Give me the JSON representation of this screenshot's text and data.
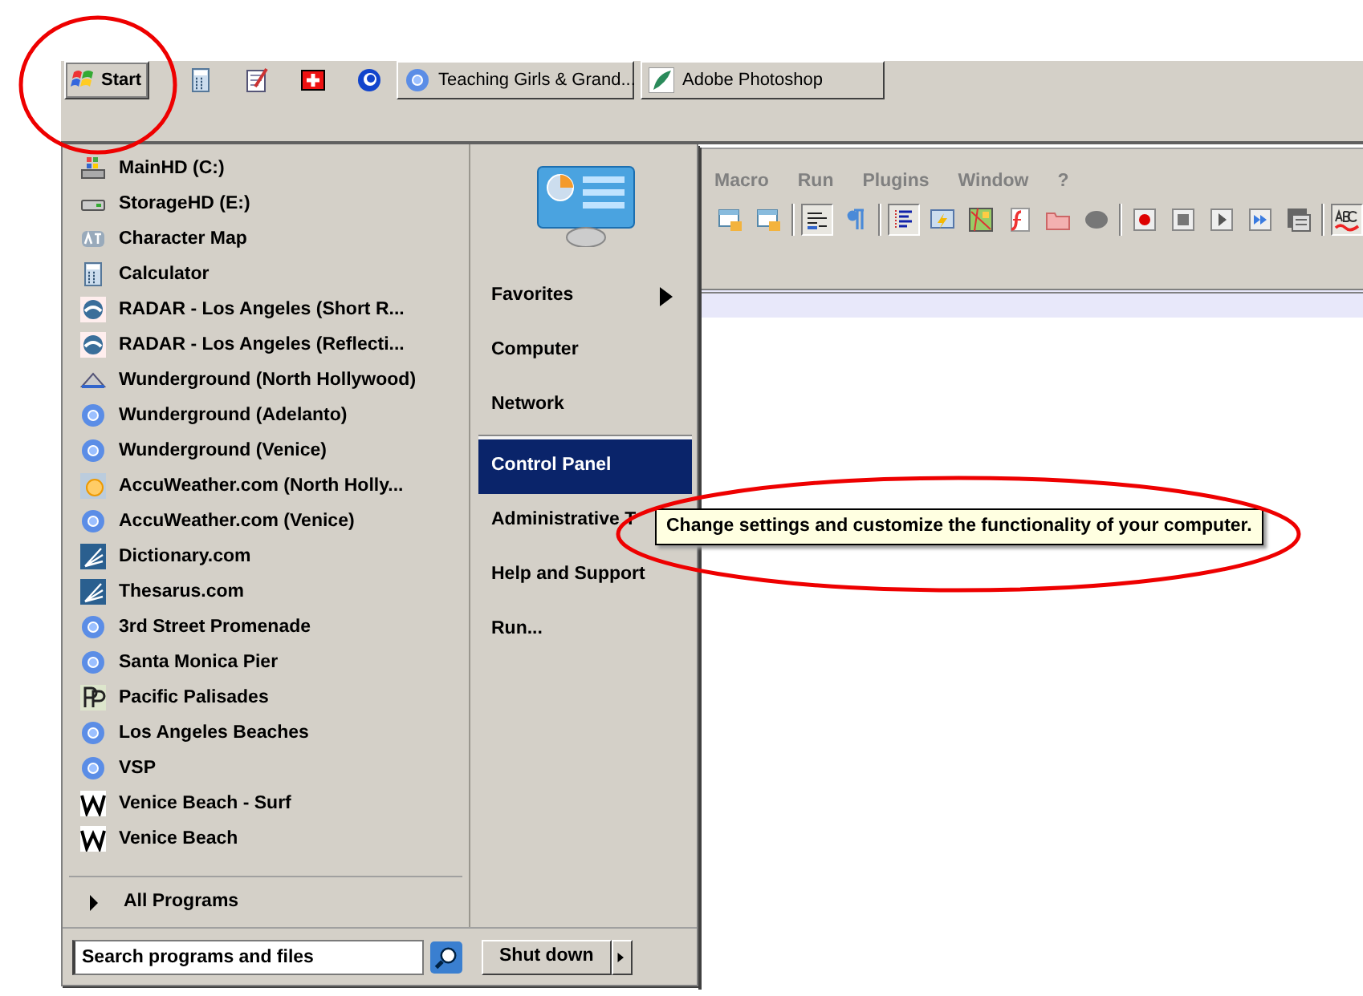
{
  "taskbar": {
    "start_button": "Start",
    "quick_launch": [
      {
        "kind": "calculator"
      },
      {
        "kind": "notepad"
      },
      {
        "kind": "firstaid"
      },
      {
        "kind": "swirl"
      }
    ],
    "tasks": [
      {
        "label": "Teaching Girls & Grand...",
        "kind": "chrome"
      },
      {
        "label": "Adobe Photoshop",
        "kind": "feather"
      }
    ]
  },
  "start_menu": {
    "programs": [
      {
        "label": "MainHD (C:)",
        "kind": "windrive"
      },
      {
        "label": "StorageHD (E:)",
        "kind": "drive"
      },
      {
        "label": "Character Map",
        "kind": "charmap"
      },
      {
        "label": "Calculator",
        "kind": "calculator"
      },
      {
        "label": "RADAR - Los Angeles (Short R...",
        "kind": "radar"
      },
      {
        "label": "RADAR - Los Angeles (Reflecti...",
        "kind": "radar"
      },
      {
        "label": "Wunderground (North Hollywood)",
        "kind": "cloud"
      },
      {
        "label": "Wunderground (Adelanto)",
        "kind": "chrome"
      },
      {
        "label": "Wunderground (Venice)",
        "kind": "chrome"
      },
      {
        "label": "AccuWeather.com (North Holly...",
        "kind": "sun"
      },
      {
        "label": "AccuWeather.com (Venice)",
        "kind": "chrome"
      },
      {
        "label": "Dictionary.com",
        "kind": "dictionary"
      },
      {
        "label": "Thesarus.com",
        "kind": "dictionary"
      },
      {
        "label": "3rd Street Promenade",
        "kind": "chrome"
      },
      {
        "label": "Santa Monica Pier",
        "kind": "chrome"
      },
      {
        "label": "Pacific Palisades",
        "kind": "pp"
      },
      {
        "label": "Los Angeles Beaches",
        "kind": "chrome"
      },
      {
        "label": "VSP",
        "kind": "chrome"
      },
      {
        "label": "Venice Beach - Surf",
        "kind": "w"
      },
      {
        "label": "Venice Beach",
        "kind": "w"
      }
    ],
    "all_programs": "All Programs",
    "places": [
      {
        "label": "Favorites",
        "submenu": true,
        "selected": false
      },
      {
        "label": "Computer",
        "submenu": false,
        "selected": false
      },
      {
        "label": "Network",
        "submenu": false,
        "selected": false
      },
      {
        "label": "Control Panel",
        "submenu": false,
        "selected": true
      },
      {
        "label": "Administrative T",
        "submenu": false,
        "selected": false
      },
      {
        "label": "Help and Support",
        "submenu": false,
        "selected": false
      },
      {
        "label": "Run...",
        "submenu": false,
        "selected": false
      }
    ],
    "search": {
      "placeholder": "Search programs and files"
    },
    "shutdown": "Shut down"
  },
  "tooltip": "Change settings and customize the functionality of your computer.",
  "app": {
    "menu": [
      "Macro",
      "Run",
      "Plugins",
      "Window",
      "?"
    ],
    "toolbar": [
      {
        "kind": "lockwin",
        "pressed": false
      },
      {
        "kind": "lockwin",
        "pressed": false
      },
      {
        "kind": "sep"
      },
      {
        "kind": "wrap",
        "pressed": true
      },
      {
        "kind": "pilcrow",
        "pressed": false
      },
      {
        "kind": "sep"
      },
      {
        "kind": "indent",
        "pressed": true
      },
      {
        "kind": "bolt",
        "pressed": false
      },
      {
        "kind": "map",
        "pressed": false
      },
      {
        "kind": "func",
        "pressed": false
      },
      {
        "kind": "folder",
        "pressed": false
      },
      {
        "kind": "blob",
        "pressed": false
      },
      {
        "kind": "sep"
      },
      {
        "kind": "record",
        "pressed": false
      },
      {
        "kind": "stop",
        "pressed": false
      },
      {
        "kind": "play",
        "pressed": false
      },
      {
        "kind": "ffwd",
        "pressed": false
      },
      {
        "kind": "save",
        "pressed": false
      },
      {
        "kind": "sep"
      },
      {
        "kind": "spell",
        "pressed": true
      }
    ]
  }
}
